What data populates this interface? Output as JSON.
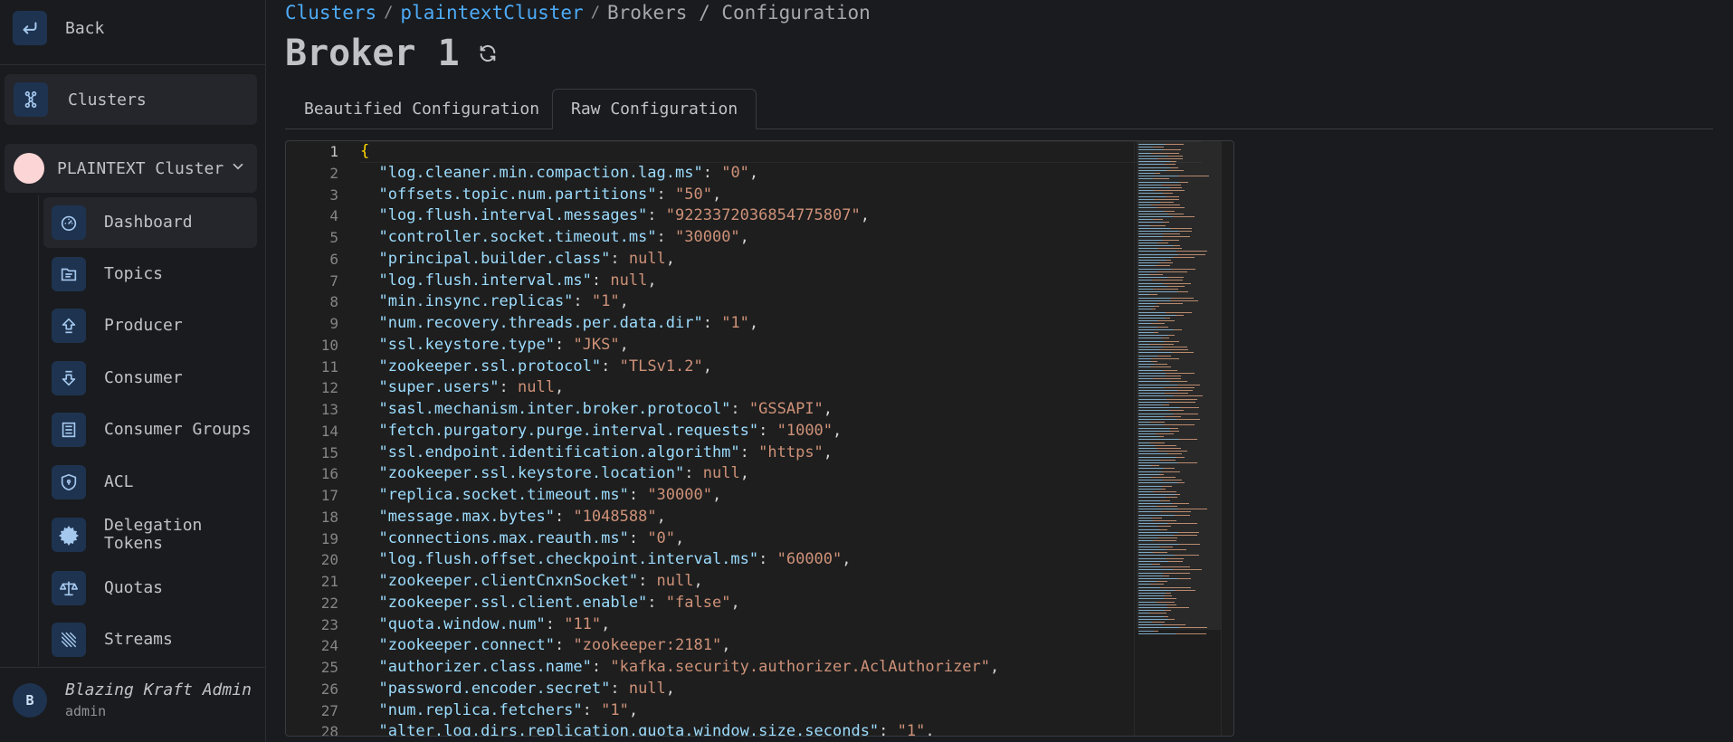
{
  "sidebar": {
    "back_label": "Back",
    "clusters_label": "Clusters",
    "cluster_name": "PLAINTEXT Cluster",
    "items": [
      {
        "label": "Dashboard",
        "icon": "dashboard-icon"
      },
      {
        "label": "Topics",
        "icon": "topics-icon"
      },
      {
        "label": "Producer",
        "icon": "producer-icon"
      },
      {
        "label": "Consumer",
        "icon": "consumer-icon"
      },
      {
        "label": "Consumer Groups",
        "icon": "consumer-groups-icon"
      },
      {
        "label": "ACL",
        "icon": "shield-icon"
      },
      {
        "label": "Delegation Tokens",
        "icon": "delegation-tokens-icon"
      },
      {
        "label": "Quotas",
        "icon": "scale-icon"
      },
      {
        "label": "Streams",
        "icon": "streams-icon"
      }
    ],
    "user": {
      "initial": "B",
      "name": "Blazing Kraft Admin",
      "role": "admin"
    }
  },
  "breadcrumb": {
    "clusters": "Clusters",
    "sep1": "/",
    "cluster": "plaintextCluster",
    "sep2": "/",
    "rest": "Brokers / Configuration"
  },
  "page": {
    "title": "Broker 1"
  },
  "tabs": [
    {
      "label": "Beautified Configuration"
    },
    {
      "label": "Raw Configuration"
    }
  ],
  "editor": {
    "open_brace": "{",
    "lines": [
      {
        "key": "\"log.cleaner.min.compaction.lag.ms\"",
        "value": "\"0\"",
        "kind": "s"
      },
      {
        "key": "\"offsets.topic.num.partitions\"",
        "value": "\"50\"",
        "kind": "s"
      },
      {
        "key": "\"log.flush.interval.messages\"",
        "value": "\"9223372036854775807\"",
        "kind": "s"
      },
      {
        "key": "\"controller.socket.timeout.ms\"",
        "value": "\"30000\"",
        "kind": "s"
      },
      {
        "key": "\"principal.builder.class\"",
        "value": "null",
        "kind": "s"
      },
      {
        "key": "\"log.flush.interval.ms\"",
        "value": "null",
        "kind": "s"
      },
      {
        "key": "\"min.insync.replicas\"",
        "value": "\"1\"",
        "kind": "s"
      },
      {
        "key": "\"num.recovery.threads.per.data.dir\"",
        "value": "\"1\"",
        "kind": "s"
      },
      {
        "key": "\"ssl.keystore.type\"",
        "value": "\"JKS\"",
        "kind": "s"
      },
      {
        "key": "\"zookeeper.ssl.protocol\"",
        "value": "\"TLSv1.2\"",
        "kind": "s"
      },
      {
        "key": "\"super.users\"",
        "value": "null",
        "kind": "s"
      },
      {
        "key": "\"sasl.mechanism.inter.broker.protocol\"",
        "value": "\"GSSAPI\"",
        "kind": "s"
      },
      {
        "key": "\"fetch.purgatory.purge.interval.requests\"",
        "value": "\"1000\"",
        "kind": "s"
      },
      {
        "key": "\"ssl.endpoint.identification.algorithm\"",
        "value": "\"https\"",
        "kind": "s"
      },
      {
        "key": "\"zookeeper.ssl.keystore.location\"",
        "value": "null",
        "kind": "s"
      },
      {
        "key": "\"replica.socket.timeout.ms\"",
        "value": "\"30000\"",
        "kind": "s"
      },
      {
        "key": "\"message.max.bytes\"",
        "value": "\"1048588\"",
        "kind": "s"
      },
      {
        "key": "\"connections.max.reauth.ms\"",
        "value": "\"0\"",
        "kind": "s"
      },
      {
        "key": "\"log.flush.offset.checkpoint.interval.ms\"",
        "value": "\"60000\"",
        "kind": "s"
      },
      {
        "key": "\"zookeeper.clientCnxnSocket\"",
        "value": "null",
        "kind": "s"
      },
      {
        "key": "\"zookeeper.ssl.client.enable\"",
        "value": "\"false\"",
        "kind": "s"
      },
      {
        "key": "\"quota.window.num\"",
        "value": "\"11\"",
        "kind": "s"
      },
      {
        "key": "\"zookeeper.connect\"",
        "value": "\"zookeeper:2181\"",
        "kind": "s"
      },
      {
        "key": "\"authorizer.class.name\"",
        "value": "\"kafka.security.authorizer.AclAuthorizer\"",
        "kind": "s"
      },
      {
        "key": "\"password.encoder.secret\"",
        "value": "null",
        "kind": "s"
      },
      {
        "key": "\"num.replica.fetchers\"",
        "value": "\"1\"",
        "kind": "s"
      },
      {
        "key": "\"alter.log.dirs.replication.quota.window.size.seconds\"",
        "value": "\"1\"",
        "kind": "s"
      }
    ]
  },
  "colors": {
    "accent": "#4dabf7",
    "json_key": "#9cdcfe",
    "json_string": "#ce9178",
    "brace": "#ffd700"
  }
}
